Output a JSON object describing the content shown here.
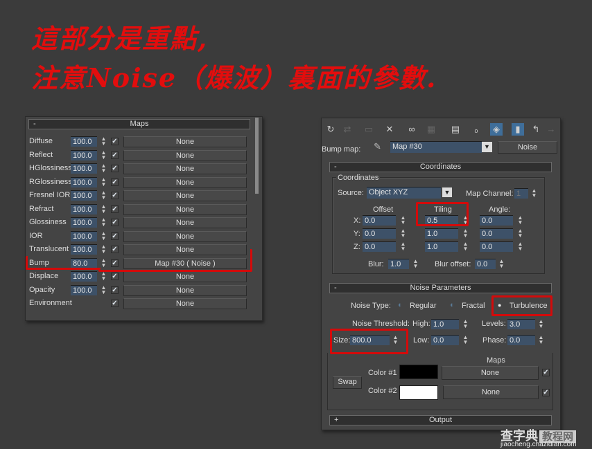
{
  "heading": {
    "line1": "這部分是重點,",
    "line2": "注意Noise（爆波）裏面的參數."
  },
  "maps_panel": {
    "title": "Maps",
    "collapse": "-",
    "rows": [
      {
        "label": "Diffuse",
        "amount": "100.0",
        "checked": true,
        "map": "None"
      },
      {
        "label": "Reflect",
        "amount": "100.0",
        "checked": true,
        "map": "None"
      },
      {
        "label": "HGlossiness",
        "amount": "100.0",
        "checked": true,
        "map": "None"
      },
      {
        "label": "RGlossiness",
        "amount": "100.0",
        "checked": true,
        "map": "None"
      },
      {
        "label": "Fresnel IOR",
        "amount": "100.0",
        "checked": true,
        "map": "None"
      },
      {
        "label": "Refract",
        "amount": "100.0",
        "checked": true,
        "map": "None"
      },
      {
        "label": "Glossiness",
        "amount": "100.0",
        "checked": true,
        "map": "None"
      },
      {
        "label": "IOR",
        "amount": "100.0",
        "checked": true,
        "map": "None"
      },
      {
        "label": "Translucent",
        "amount": "100.0",
        "checked": true,
        "map": "None"
      },
      {
        "label": "Bump",
        "amount": "80.0",
        "checked": true,
        "map": "Map #30  ( Noise )"
      },
      {
        "label": "Displace",
        "amount": "100.0",
        "checked": true,
        "map": "None"
      },
      {
        "label": "Opacity",
        "amount": "100.0",
        "checked": true,
        "map": "None"
      },
      {
        "label": "Environment",
        "amount": null,
        "checked": true,
        "map": "None"
      }
    ]
  },
  "noise_panel": {
    "bump_map_label": "Bump map:",
    "map_name": "Map #30",
    "map_type": "Noise",
    "coordinates": {
      "title": "Coordinates",
      "collapse": "-",
      "group_label": "Coordinates",
      "source_label": "Source:",
      "source_value": "Object XYZ",
      "map_channel_label": "Map Channel:",
      "map_channel_value": "1",
      "offset_label": "Offset",
      "tiling_label": "Tiling",
      "angle_label": "Angle:",
      "axes": [
        {
          "axis": "X:",
          "offset": "0.0",
          "tiling": "0.5",
          "angle": "0.0"
        },
        {
          "axis": "Y:",
          "offset": "0.0",
          "tiling": "1.0",
          "angle": "0.0"
        },
        {
          "axis": "Z:",
          "offset": "0.0",
          "tiling": "1.0",
          "angle": "0.0"
        }
      ],
      "blur_label": "Blur:",
      "blur": "1.0",
      "blur_offset_label": "Blur offset:",
      "blur_offset": "0.0"
    },
    "noise_params": {
      "title": "Noise Parameters",
      "collapse": "-",
      "noise_type_label": "Noise Type:",
      "types": [
        "Regular",
        "Fractal",
        "Turbulence"
      ],
      "selected_type": "Turbulence",
      "threshold_label": "Noise Threshold:",
      "high_label": "High:",
      "high": "1.0",
      "low_label": "Low:",
      "low": "0.0",
      "levels_label": "Levels:",
      "levels": "3.0",
      "phase_label": "Phase:",
      "phase": "0.0",
      "size_label": "Size:",
      "size": "800.0",
      "maps_label": "Maps",
      "swap_label": "Swap",
      "color1_label": "Color #1",
      "color1": "#000000",
      "color1_map": "None",
      "color2_label": "Color #2",
      "color2": "#ffffff",
      "color2_map": "None"
    },
    "output": {
      "title": "Output",
      "collapse": "+"
    }
  },
  "watermark": {
    "brand": "查字典",
    "brand2": "教程网",
    "url": "jiaocheng.chazidian.com"
  },
  "colors": {
    "highlight": "#d40a0a",
    "input": "#3d5168"
  }
}
